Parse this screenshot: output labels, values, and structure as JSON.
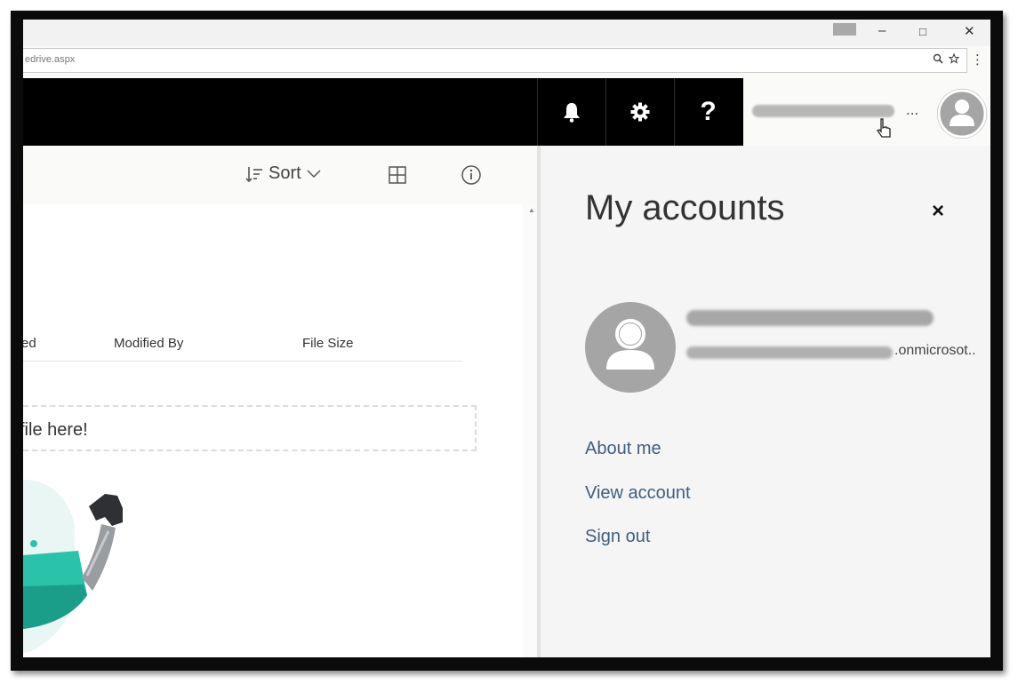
{
  "browser": {
    "url_fragment": "edrive.aspx",
    "window_controls": [
      "–",
      "□",
      "✕"
    ],
    "menu_icon": "kebab-menu-icon"
  },
  "suite_bar": {
    "buttons": [
      {
        "icon": "bell-icon"
      },
      {
        "icon": "gear-icon"
      },
      {
        "icon": "help-icon",
        "label": "?"
      }
    ],
    "ellipsis": "..."
  },
  "command_bar": {
    "sort_label": "Sort"
  },
  "file_list": {
    "columns": [
      "ed",
      "Modified By",
      "File Size"
    ],
    "drop_text": "file here!"
  },
  "accounts_panel": {
    "title": "My accounts",
    "close_label": "×",
    "email_suffix": ".onmicrosot..",
    "links": [
      "About me",
      "View account",
      "Sign out"
    ]
  },
  "colors": {
    "suite_bar_bg": "#000000",
    "link": "#3f5e80",
    "avatar_bg": "#a5a5a5",
    "robot_teal": "#27c6ad"
  }
}
